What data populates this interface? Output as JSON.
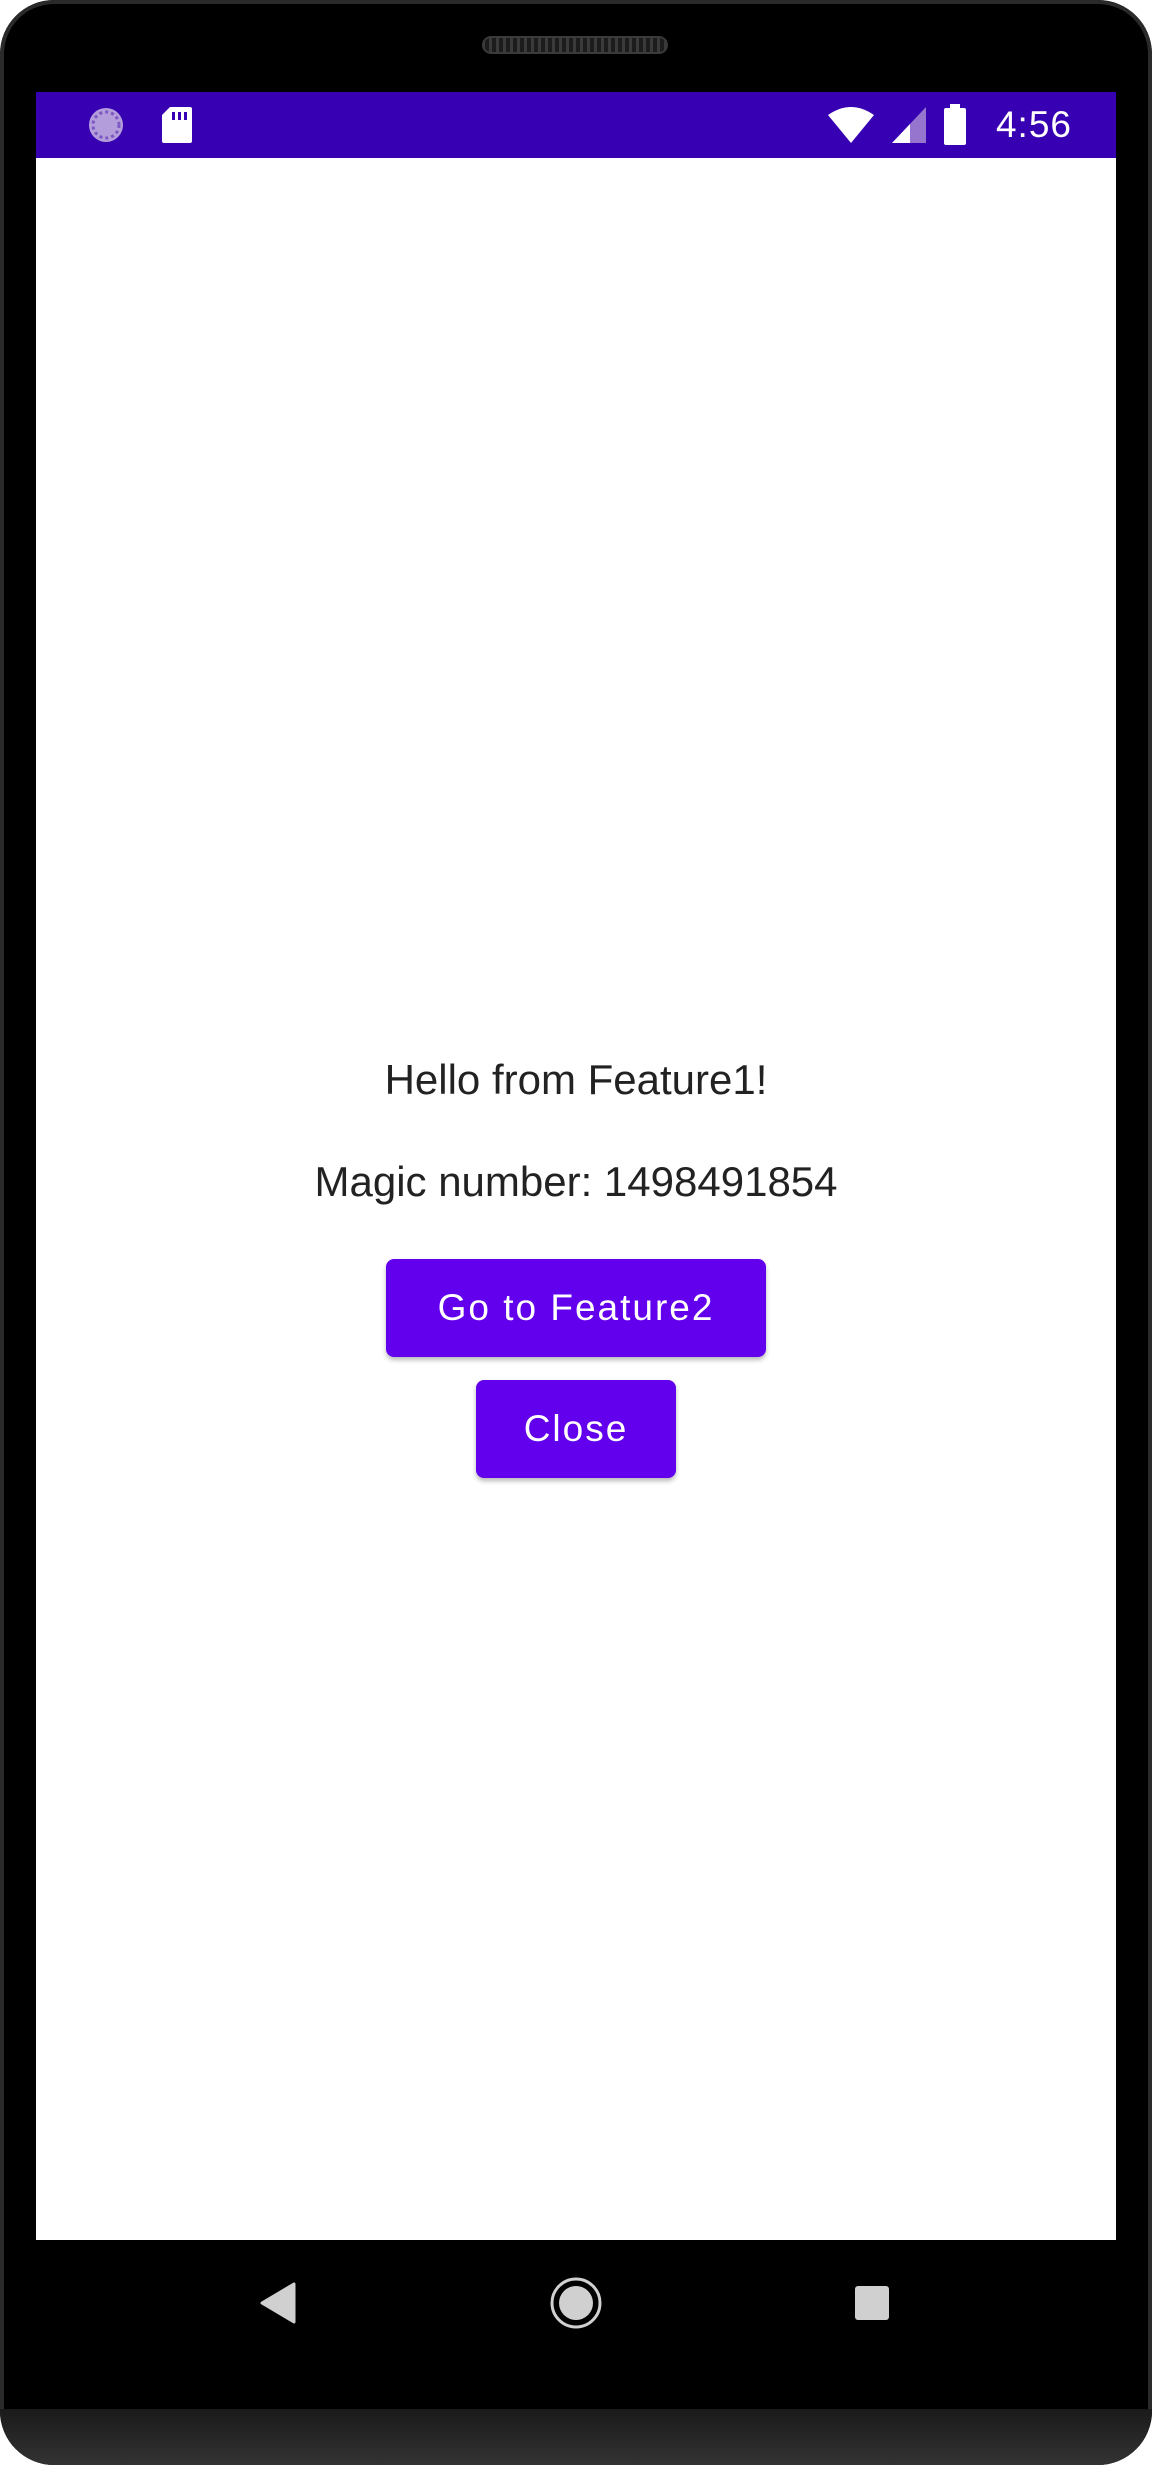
{
  "status_bar": {
    "time": "4:56",
    "color": "#3700b3",
    "left_icons": [
      "sync-icon",
      "sd-card-icon"
    ],
    "right_icons": [
      "wifi-icon",
      "cell-signal-icon",
      "battery-icon"
    ]
  },
  "main": {
    "greeting": "Hello from Feature1!",
    "magic_number_text": "Magic number: 1498491854",
    "go_to_feature2_label": "Go to Feature2",
    "close_label": "Close"
  },
  "navigation_bar": {
    "buttons": [
      "back-icon",
      "home-icon",
      "recents-icon"
    ]
  },
  "colors": {
    "accent": "#6200ee",
    "status_bar": "#3700b3",
    "text": "#222222",
    "background": "#ffffff"
  }
}
